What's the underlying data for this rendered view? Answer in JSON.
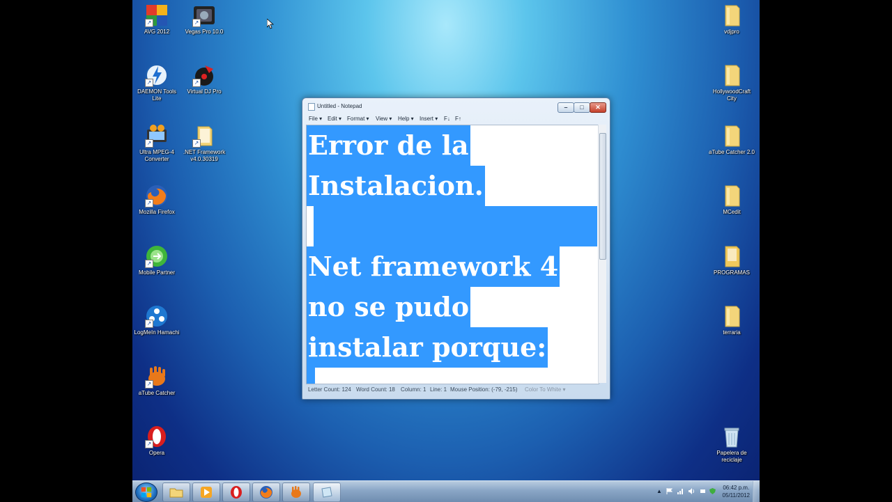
{
  "desktop": {
    "icons_left": [
      {
        "label": "AVG 2012"
      },
      {
        "label": "DAEMON Tools Lite"
      },
      {
        "label": "Ultra MPEG-4 Converter"
      },
      {
        "label": "Mozilla Firefox"
      },
      {
        "label": "Mobile Partner"
      },
      {
        "label": "LogMeIn Hamachi"
      },
      {
        "label": "aTube Catcher"
      },
      {
        "label": "Opera"
      }
    ],
    "icons_second": [
      {
        "label": "Vegas Pro 10.0"
      },
      {
        "label": "Virtual DJ Pro"
      },
      {
        "label": ".NET Framework v4.0.30319"
      }
    ],
    "icons_right": [
      {
        "label": "vdjpro"
      },
      {
        "label": "HollywoodCraft City"
      },
      {
        "label": "aTube Catcher 2.0"
      },
      {
        "label": "MCedit"
      },
      {
        "label": "PROGRAMAS"
      },
      {
        "label": "terraria"
      },
      {
        "label": "Papelera de reciclaje"
      }
    ]
  },
  "notepad": {
    "title": "Untitled - Notepad",
    "menu": [
      "File ▾",
      "Edit ▾",
      "Format ▾",
      "View ▾",
      "Help ▾",
      "Insert ▾",
      "F↓",
      "F↑"
    ],
    "text_lines": [
      "Error de la",
      "Instalacion.",
      " ",
      "Net framework 4",
      "no se pudo",
      "instalar porque:"
    ],
    "status": {
      "letter_count": "Letter Count: 124",
      "word_count": "Word Count: 18",
      "column": "Column: 1",
      "line": "Line: 1",
      "mouse_position": "Mouse Position: (-79, -215)",
      "color": "Color To White ▾"
    }
  },
  "taskbar": {
    "clock_time": "06:42 p.m.",
    "clock_date": "05/11/2012"
  },
  "colors": {
    "selection": "#3399ff",
    "desktop_top": "#a8e8fb",
    "desktop_bottom": "#0a2270"
  }
}
